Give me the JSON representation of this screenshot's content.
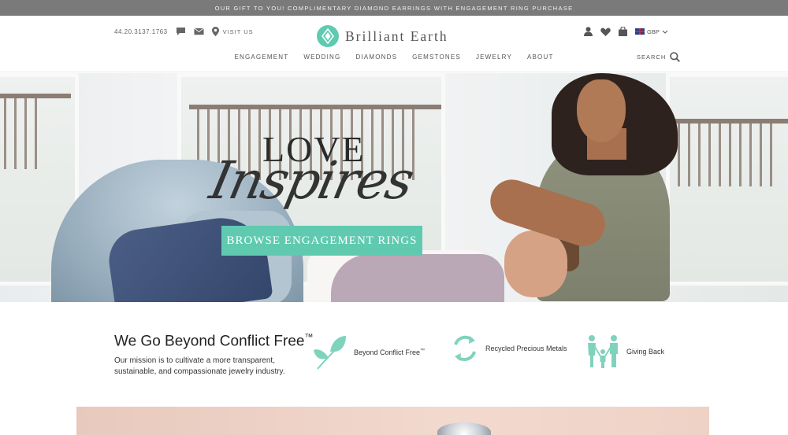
{
  "promo": {
    "text": "OUR GIFT TO YOU! COMPLIMENTARY DIAMOND EARRINGS WITH ENGAGEMENT RING PURCHASE"
  },
  "header": {
    "phone": "44.20.3137.1763",
    "visit_label": "VISIT US",
    "logo_text": "Brilliant Earth",
    "currency": "GBP",
    "search_label": "SEARCH",
    "nav": [
      "ENGAGEMENT",
      "WEDDING",
      "DIAMONDS",
      "GEMSTONES",
      "JEWELRY",
      "ABOUT"
    ]
  },
  "hero": {
    "line1": "LOVE",
    "line2": "Inspires",
    "cta": "BROWSE ENGAGEMENT RINGS"
  },
  "mission": {
    "title": "We Go Beyond Conflict Free",
    "title_mark": "™",
    "body": "Our mission is to cultivate a more transparent, sustainable, and compassionate jewelry industry.",
    "features": [
      {
        "label": "Beyond Conflict Free",
        "mark": "™",
        "icon": "leaf-icon"
      },
      {
        "label": "Recycled Precious Metals",
        "mark": "",
        "icon": "recycle-icon"
      },
      {
        "label": "Giving Back",
        "mark": "",
        "icon": "family-icon"
      }
    ]
  },
  "colors": {
    "accent": "#5fcab0",
    "promo_bar": "#7a7a7a",
    "text": "#333333"
  }
}
